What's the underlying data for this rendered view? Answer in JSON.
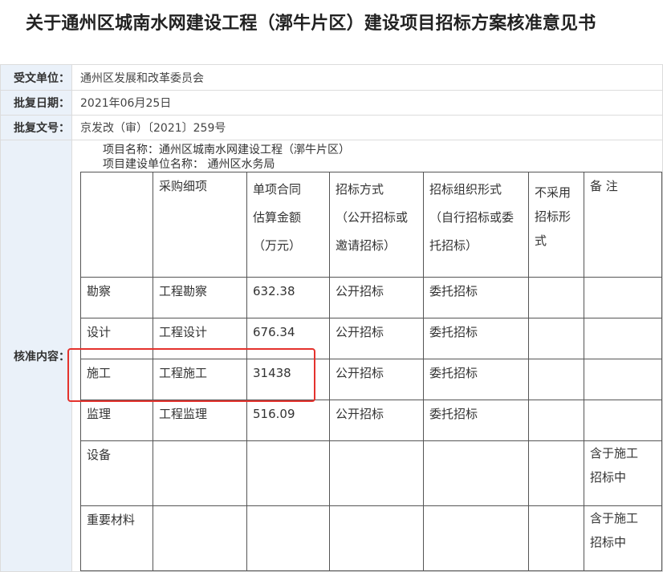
{
  "document": {
    "title": "关于通州区城南水网建设工程（漷牛片区）建设项目招标方案核准意见书"
  },
  "info": {
    "receiver_label": "受文单位：",
    "receiver_value": "通州区发展和改革委员会",
    "date_label": "批复日期：",
    "date_value": "2021年06月25日",
    "doc_no_label": "批复文号：",
    "doc_no_value": "京发改（审）〔2021〕259号",
    "content_label": "核准内容："
  },
  "content": {
    "project_line": "项目名称：通州区城南水网建设工程（漷牛片区）",
    "unit_line": "项目建设单位名称： 通州区水务局"
  },
  "table": {
    "headers": {
      "col1": "",
      "col2": "采购细项",
      "col3": [
        "单项合同",
        "估算金额",
        "（万元）"
      ],
      "col4": [
        "招标方式",
        "（公开招标或",
        "邀请招标）"
      ],
      "col5": [
        "招标组织形式",
        "（自行招标或委",
        "托招标）"
      ],
      "col6": [
        "不采用",
        "招标形",
        "式"
      ],
      "col7": "备 注"
    },
    "rows": [
      {
        "category": "勘察",
        "item": "工程勘察",
        "amount": "632.38",
        "method": "公开招标",
        "org": "委托招标",
        "no_bid": "",
        "note": ""
      },
      {
        "category": "设计",
        "item": "工程设计",
        "amount": "676.34",
        "method": "公开招标",
        "org": "委托招标",
        "no_bid": "",
        "note": ""
      },
      {
        "category": "施工",
        "item": "工程施工",
        "amount": "31438",
        "method": "公开招标",
        "org": "委托招标",
        "no_bid": "",
        "note": ""
      },
      {
        "category": "监理",
        "item": "工程监理",
        "amount": "516.09",
        "method": "公开招标",
        "org": "委托招标",
        "no_bid": "",
        "note": ""
      },
      {
        "category": "设备",
        "item": "",
        "amount": "",
        "method": "",
        "org": "",
        "no_bid": "",
        "note": [
          "含于施工",
          "招标中"
        ]
      },
      {
        "category": "重要材料",
        "item": "",
        "amount": "",
        "method": "",
        "org": "",
        "no_bid": "",
        "note": [
          "含于施工",
          "招标中"
        ]
      }
    ]
  },
  "colors": {
    "label_bg": "#eaf1f9",
    "highlight": "#e4322d"
  }
}
